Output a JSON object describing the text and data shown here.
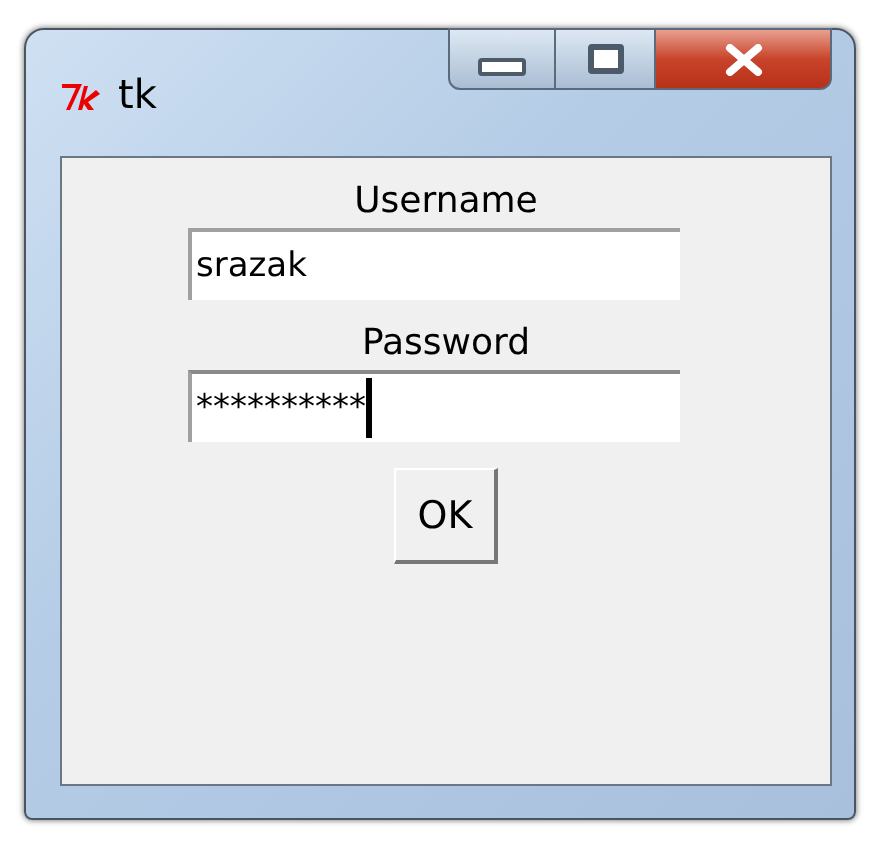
{
  "window": {
    "title": "tk"
  },
  "fields": [
    {
      "label": "Username",
      "value": "srazak",
      "focused": false
    },
    {
      "label": "Password",
      "value": "**********",
      "focused": true
    }
  ],
  "buttons": [
    "OK"
  ]
}
